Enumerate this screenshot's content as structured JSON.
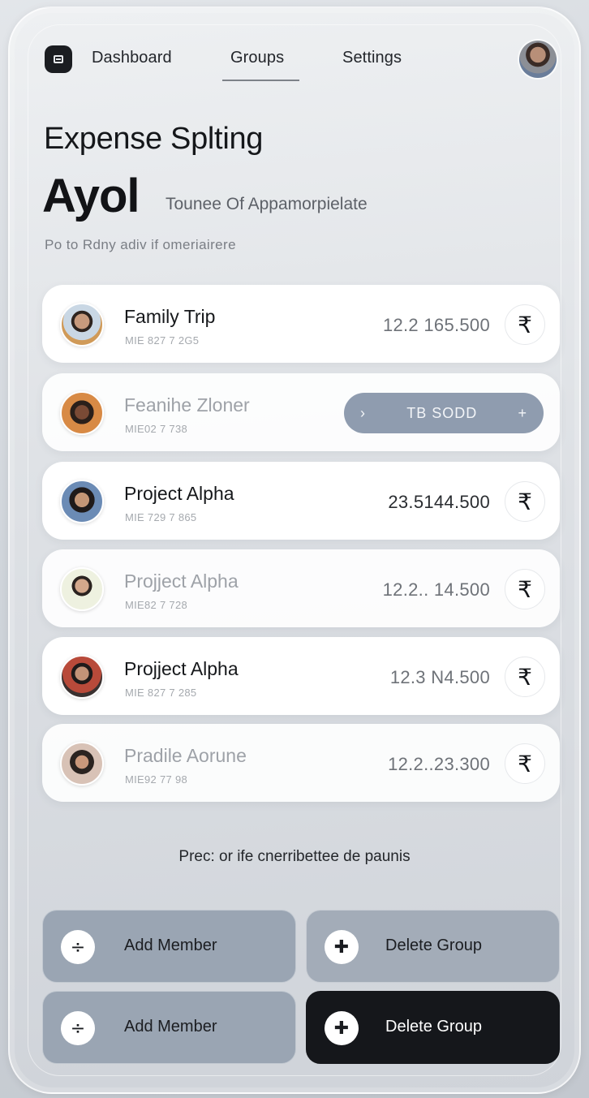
{
  "nav": {
    "items": [
      "Dashboard",
      "Groups",
      "Settings"
    ],
    "active": "Groups"
  },
  "header": {
    "title": "Expense Splting",
    "big_title": "Ayol",
    "subtitle": "Tounee Of Appamorpielate",
    "tagline": "Po to Rdny adiv if omeriairere"
  },
  "groups": [
    {
      "name": "Family Trip",
      "meta": "MIE 827 7 2G5",
      "amount": "12.2 165.500",
      "action": "₹"
    },
    {
      "name": "Feanihe Zloner",
      "meta": "MIE02 7 738",
      "amount": "",
      "pill_text": "TB SODD",
      "pill_left": "›",
      "pill_right": "+"
    },
    {
      "name": "Project Alpha",
      "meta": "MIE 729 7 865",
      "amount": "23.5144.500",
      "action": "₹"
    },
    {
      "name": "Projject Alpha",
      "meta": "MIE82 7 728",
      "amount": "12.2.. 14.500",
      "action": "₹"
    },
    {
      "name": "Projject Alpha",
      "meta": "MIE 827 7 285",
      "amount": "12.3 N4.500",
      "action": "₹"
    },
    {
      "name": "Pradile Aorune",
      "meta": "MIE92 77 98",
      "amount": "12.2..23.300",
      "action": "₹"
    }
  ],
  "footer_text": "Prec: or ife cnerribettee de paunis",
  "actions": {
    "add_member": "Add Member",
    "delete_group": "Delete Group",
    "add_icon": "÷",
    "delete_icon": "✚"
  },
  "colors": {
    "accent_dark": "#15171b",
    "button_gray": "#9aa5b3",
    "pill": "#8f9caf"
  }
}
